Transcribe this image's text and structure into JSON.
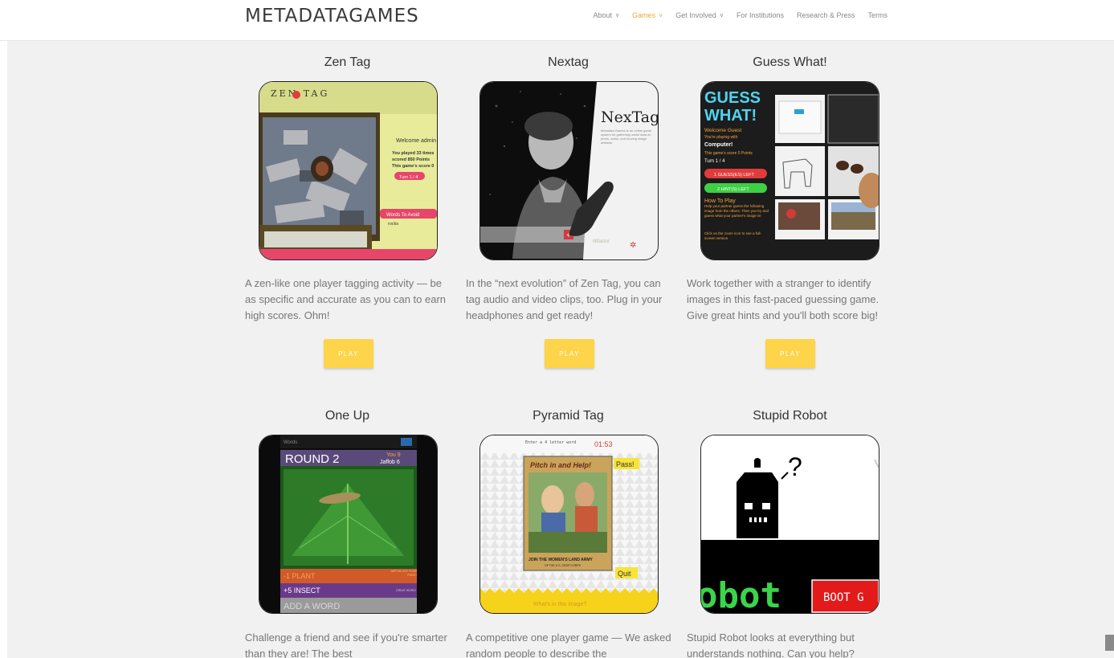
{
  "header": {
    "logo": "METADATAGAMES",
    "nav": [
      {
        "label": "About",
        "dropdown": true,
        "active": false
      },
      {
        "label": "Games",
        "dropdown": true,
        "active": true
      },
      {
        "label": "Get Involved",
        "dropdown": true,
        "active": false
      },
      {
        "label": "For Institutions",
        "dropdown": false,
        "active": false
      },
      {
        "label": "Research & Press",
        "dropdown": false,
        "active": false
      },
      {
        "label": "Terms",
        "dropdown": false,
        "active": false
      }
    ]
  },
  "games": [
    {
      "title": "Zen Tag",
      "description": "A zen-like one player tagging activity — be as specific and accurate as you can to earn high scores. Ohm!",
      "play_label": "PLAY"
    },
    {
      "title": "Nextag",
      "description": "In the “next evolution” of Zen Tag, you can tag audio and video clips, too. Plug in your headphones and get ready!",
      "play_label": "PLAY"
    },
    {
      "title": "Guess What!",
      "description": "Work together with a stranger to identify images in this fast-paced guessing game. Give great hints and you'll both score big!",
      "play_label": "PLAY"
    },
    {
      "title": "One Up",
      "description": "Challenge a friend and see if you're smarter than they are! The best"
    },
    {
      "title": "Pyramid Tag",
      "description": "A competitive one player game — We asked random people to describe the"
    },
    {
      "title": "Stupid Robot",
      "description": "Stupid Robot looks at everything but understands nothing. Can you help?"
    }
  ],
  "thumbs": {
    "zentag": {
      "logo": "ZEN TAG",
      "welcome": "Welcome admin",
      "played": "You played 33 times",
      "scored": "scored 850 Points",
      "score": "This game's score 0",
      "turn": "Turn 1 / 4",
      "avoid": "Words To Avoid",
      "rocks": "rocks"
    },
    "nextag": {
      "logo": "NexTag",
      "blurb": "Metadata Games is an online game system for gathering useful data on photo, audio, and moving image artifacts",
      "brand": "tiltfactor"
    },
    "guesswhat": {
      "logo1": "GUESS",
      "logo2": "WHAT!",
      "welcome": "Welcome Guest",
      "playing": "You're playing with",
      "computer": "Computer!",
      "score": "This game's score 0 Points",
      "turn": "Turn 1 / 4",
      "guesses": "1 GUESS(ES) LEFT",
      "hints": "2 HINT(S) LEFT",
      "howto": "How To Play",
      "instructions": "Help your partner guess the following image from the others. Then you try and guess what your partner's image is!",
      "zoom": "Click on the zoom icon to see a full-screen version"
    },
    "oneup": {
      "words": "Words",
      "round": "ROUND 2",
      "you": "You 9",
      "jaffob": "Jaffob 6",
      "plant": "-1 PLANT",
      "plant_note": "JAFFOB GOT YOUR POINT!",
      "insect": "+5 INSECT",
      "insect_note": "GREAT WORD!",
      "add": "ADD A WORD"
    },
    "pyramid": {
      "prompt": "Enter a 4 letter word",
      "timer": "01:53",
      "poster_title": "Pitch in and Help!",
      "poster_footer": "JOIN THE WOMEN'S LAND ARMY",
      "poster_sub": "OF THE U.S. CROP CORPS",
      "pass": "Pass!",
      "quit": "Quit",
      "question": "What's in this image?"
    },
    "robot": {
      "question_mark": "?",
      "banner": "obot",
      "boot": "BOOT G"
    }
  },
  "colors": {
    "accent_orange": "#f0a53a",
    "play_yellow": "#fdd44a",
    "page_bg": "#f1f1f1"
  },
  "icons": {
    "nav_dropdown": "chevron-down-icon",
    "scroll": "scroll-to-top-icon"
  }
}
